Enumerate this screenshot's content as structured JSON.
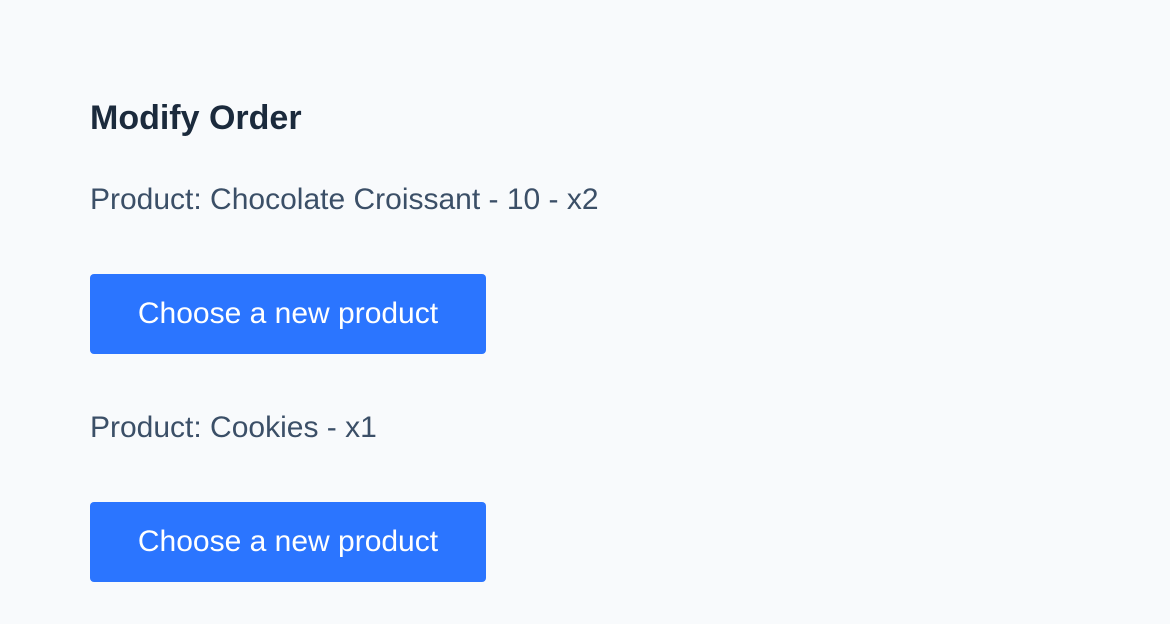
{
  "page": {
    "title": "Modify Order"
  },
  "order": {
    "items": [
      {
        "product_text": "Product: Chocolate Croissant - 10 - x2",
        "button_label": "Choose a new product"
      },
      {
        "product_text": "Product: Cookies - x1",
        "button_label": "Choose a new product"
      }
    ]
  },
  "colors": {
    "background": "#f8fafc",
    "title": "#1b2a3c",
    "text": "#3b4f67",
    "button": "#2b75ff",
    "button_text": "#ffffff"
  }
}
